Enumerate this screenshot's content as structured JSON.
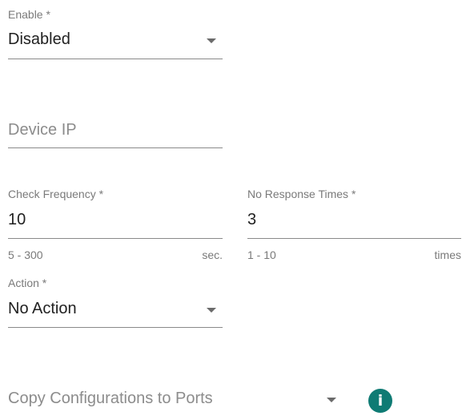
{
  "enable": {
    "label": "Enable *",
    "value": "Disabled"
  },
  "device_ip": {
    "placeholder": "Device IP",
    "value": ""
  },
  "check_frequency": {
    "label": "Check Frequency *",
    "value": "10",
    "range_hint": "5 - 300",
    "unit": "sec."
  },
  "no_response_times": {
    "label": "No Response Times *",
    "value": "3",
    "range_hint": "1 - 10",
    "unit": "times"
  },
  "action": {
    "label": "Action *",
    "value": "No Action"
  },
  "copy_config": {
    "placeholder": "Copy Configurations to Ports",
    "info_icon_glyph": "i",
    "info_icon_color": "#0f7b74"
  }
}
